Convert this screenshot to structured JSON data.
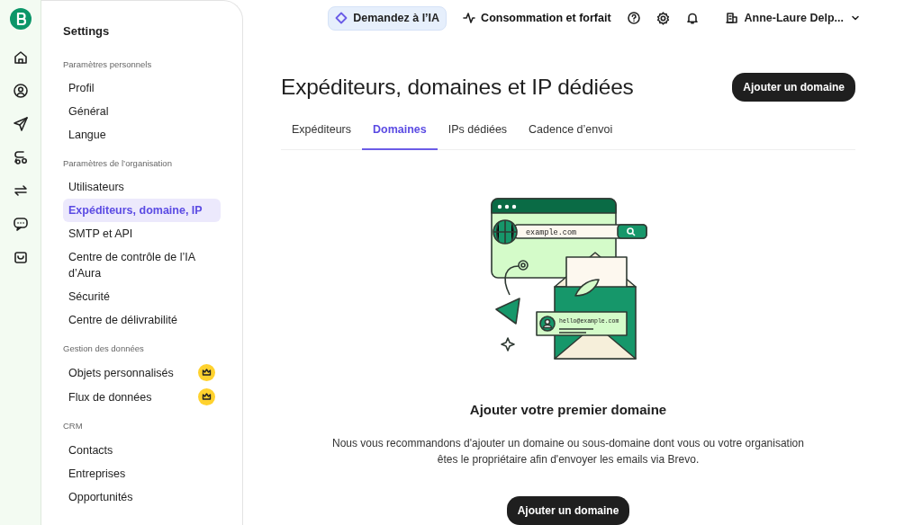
{
  "topbar": {
    "ai_button": "Demandez à l’IA",
    "usage_link": "Consommation et forfait",
    "account": "Anne-Laure Delp..."
  },
  "sidebar": {
    "title": "Settings",
    "sections": [
      {
        "heading": "Paramètres personnels",
        "items": [
          {
            "label": "Profil",
            "selected": false,
            "premium": false
          },
          {
            "label": "Général",
            "selected": false,
            "premium": false
          },
          {
            "label": "Langue",
            "selected": false,
            "premium": false
          }
        ]
      },
      {
        "heading": "Paramètres de l’organisation",
        "items": [
          {
            "label": "Utilisateurs",
            "selected": false,
            "premium": false
          },
          {
            "label": "Expéditeurs, domaine, IP",
            "selected": true,
            "premium": false
          },
          {
            "label": "SMTP et API",
            "selected": false,
            "premium": false
          },
          {
            "label": "Centre de contrôle de l’IA d’Aura",
            "selected": false,
            "premium": false
          },
          {
            "label": "Sécurité",
            "selected": false,
            "premium": false
          },
          {
            "label": "Centre de délivrabilité",
            "selected": false,
            "premium": false
          }
        ]
      },
      {
        "heading": "Gestion des données",
        "items": [
          {
            "label": "Objets personnalisés",
            "selected": false,
            "premium": true
          },
          {
            "label": "Flux de données",
            "selected": false,
            "premium": true
          }
        ]
      },
      {
        "heading": "CRM",
        "items": [
          {
            "label": "Contacts",
            "selected": false,
            "premium": false
          },
          {
            "label": "Entreprises",
            "selected": false,
            "premium": false
          },
          {
            "label": "Opportunités",
            "selected": false,
            "premium": false
          }
        ]
      }
    ]
  },
  "page": {
    "title": "Expéditeurs, domaines et IP dédiées",
    "add_button": "Ajouter un domaine",
    "tabs": [
      {
        "label": "Expéditeurs",
        "selected": false
      },
      {
        "label": "Domaines",
        "selected": true
      },
      {
        "label": "IPs dédiées",
        "selected": false
      },
      {
        "label": "Cadence d’envoi",
        "selected": false
      }
    ],
    "illustration": {
      "url_text": "example.com",
      "email_text": "hello@example.com"
    },
    "empty_state": {
      "heading": "Ajouter votre premier domaine",
      "text": "Nous vous recommandons d'ajouter un domaine ou sous-domaine dont vous ou votre organisation êtes le propriétaire afin d'envoyer les emails via Brevo.",
      "button": "Ajouter un domaine"
    }
  }
}
